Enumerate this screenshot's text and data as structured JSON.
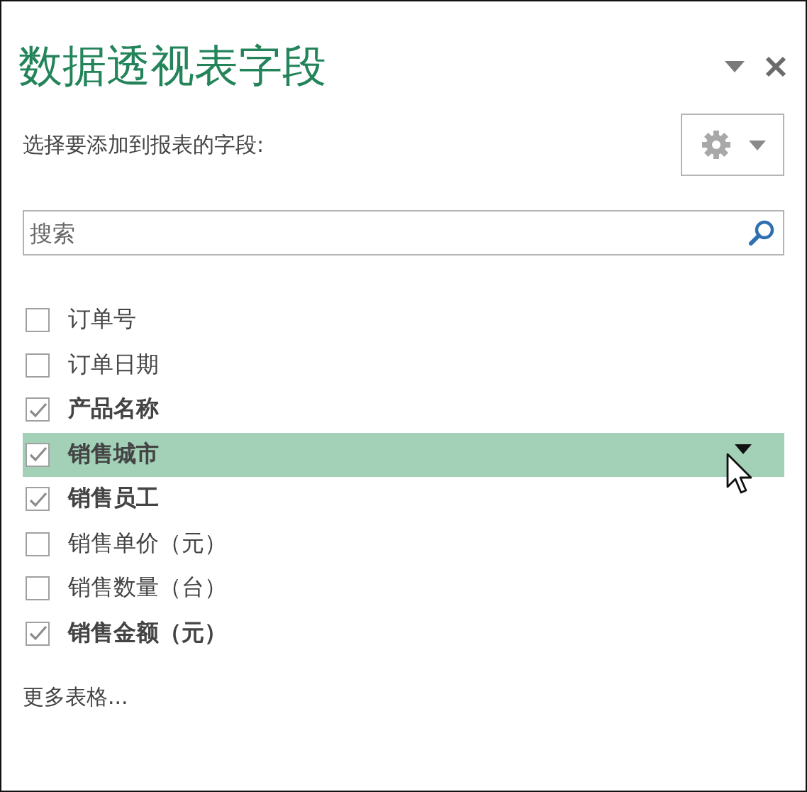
{
  "pane": {
    "title": "数据透视表字段",
    "subtitle": "选择要添加到报表的字段:"
  },
  "search": {
    "placeholder": "搜索"
  },
  "fields": [
    {
      "label": "订单号",
      "checked": false,
      "selected": false
    },
    {
      "label": "订单日期",
      "checked": false,
      "selected": false
    },
    {
      "label": "产品名称",
      "checked": true,
      "selected": false
    },
    {
      "label": "销售城市",
      "checked": true,
      "selected": true
    },
    {
      "label": "销售员工",
      "checked": true,
      "selected": false
    },
    {
      "label": "销售单价（元）",
      "checked": false,
      "selected": false
    },
    {
      "label": "销售数量（台）",
      "checked": false,
      "selected": false
    },
    {
      "label": "销售金额（元）",
      "checked": true,
      "selected": false
    }
  ],
  "more_tables": "更多表格..."
}
